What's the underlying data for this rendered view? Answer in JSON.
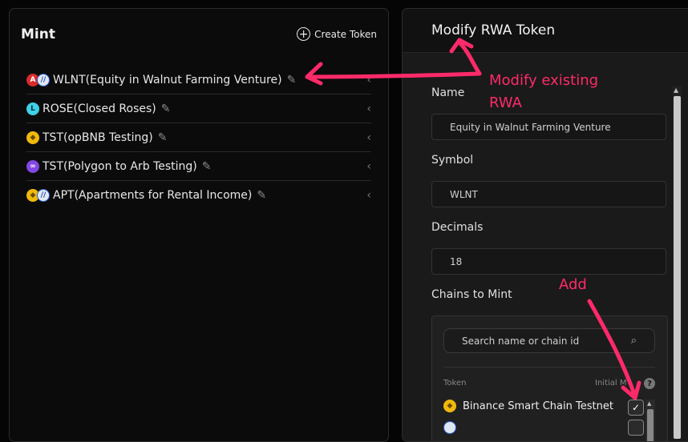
{
  "mint_panel": {
    "title": "Mint",
    "create_label": "Create Token",
    "tokens": [
      {
        "label": "WLNT(Equity in Walnut Farming Venture)",
        "icons": [
          "avalanche-icon",
          "arbitrum-icon"
        ]
      },
      {
        "label": "ROSE(Closed Roses)",
        "icons": [
          "oasis-icon"
        ]
      },
      {
        "label": "TST(opBNB Testing)",
        "icons": [
          "bnb-icon"
        ]
      },
      {
        "label": "TST(Polygon to Arb Testing)",
        "icons": [
          "polygon-icon"
        ]
      },
      {
        "label": "APT(Apartments for Rental Income)",
        "icons": [
          "bnb-icon",
          "arbitrum-icon"
        ]
      }
    ]
  },
  "modify_panel": {
    "title": "Modify RWA Token",
    "name_label": "Name",
    "name_value": "Equity in Walnut Farming Venture",
    "symbol_label": "Symbol",
    "symbol_value": "WLNT",
    "decimals_label": "Decimals",
    "decimals_value": "18",
    "chains_label": "Chains to Mint",
    "search_placeholder": "Search name or chain id",
    "col_token": "Token",
    "col_initial": "Initial M",
    "chains": [
      {
        "label": "Binance Smart Chain Testnet",
        "checked": true,
        "icon": "bnb-icon"
      }
    ]
  },
  "annotations": {
    "modify_line1": "Modify existing",
    "modify_line2": "RWA",
    "add": "Add",
    "color": "#ff2a6a"
  },
  "colors": {
    "background": "#050505",
    "panel": "#0b0b0b",
    "form_panel": "#1a1a1a"
  }
}
